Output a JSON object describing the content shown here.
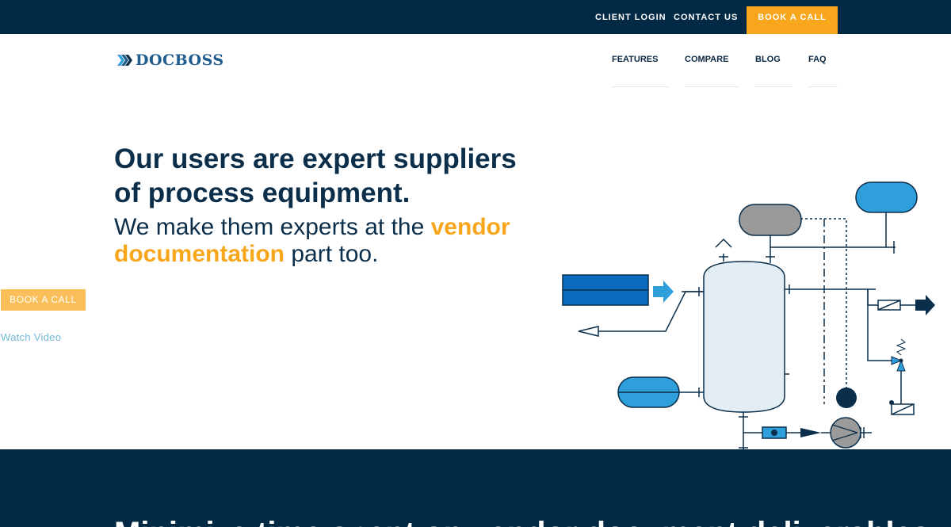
{
  "topbar": {
    "client_login": "CLIENT LOGIN",
    "contact_us": "CONTACT US",
    "book_a_call": "BOOK A CALL"
  },
  "logo": {
    "text": "DOCBOSS",
    "icon": "chevrons-icon"
  },
  "nav": {
    "items": [
      {
        "label": "FEATURES"
      },
      {
        "label": "COMPARE"
      },
      {
        "label": "BLOG"
      },
      {
        "label": "FAQ"
      }
    ]
  },
  "hero": {
    "headline_line1": "Our users are expert suppliers",
    "headline_line2": "of process equipment.",
    "sub_part1": "We make them experts at the ",
    "sub_highlight1": "vendor",
    "sub_highlight2": "documentation",
    "sub_part2": " part too.",
    "cta_label": "BOOK A CALL",
    "watch_video": "Watch Video"
  },
  "bottom": {
    "heading_partial": "Minimize time spent on vendor document deliverables"
  },
  "colors": {
    "navy": "#022a44",
    "accent": "#f8a61c",
    "light_accent": "#fbbf5a",
    "link": "#72b8d8",
    "diagram_blue": "#2f9fdc",
    "diagram_dark_blue": "#0a6bbf",
    "diagram_gray": "#9a9a9a"
  }
}
